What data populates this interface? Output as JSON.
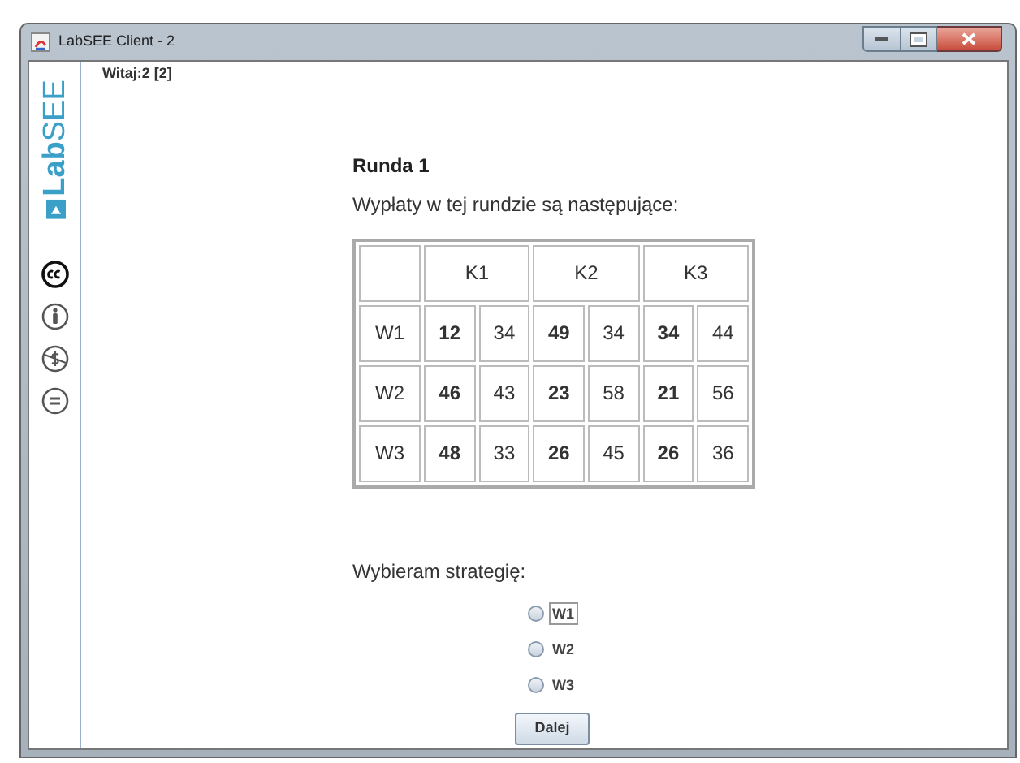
{
  "window": {
    "title": "LabSEE Client - 2"
  },
  "sidebar": {
    "logo": "**Lab**SEE"
  },
  "greeting": "Witaj:2 [2]",
  "round_title": "Runda 1",
  "intro": "Wypłaty w tej rundzie są następujące:",
  "table": {
    "columns": [
      "K1",
      "K2",
      "K3"
    ],
    "rows": [
      {
        "label": "W1",
        "values": [
          "12",
          "34",
          "49",
          "34",
          "34",
          "44"
        ]
      },
      {
        "label": "W2",
        "values": [
          "46",
          "43",
          "23",
          "58",
          "21",
          "56"
        ]
      },
      {
        "label": "W3",
        "values": [
          "48",
          "33",
          "26",
          "45",
          "26",
          "36"
        ]
      }
    ]
  },
  "strategy": {
    "label": "Wybieram strategię:",
    "options": [
      {
        "label": "W1",
        "selected": false,
        "focused": true
      },
      {
        "label": "W2",
        "selected": false,
        "focused": false
      },
      {
        "label": "W3",
        "selected": false,
        "focused": false
      }
    ]
  },
  "button": "Dalej"
}
